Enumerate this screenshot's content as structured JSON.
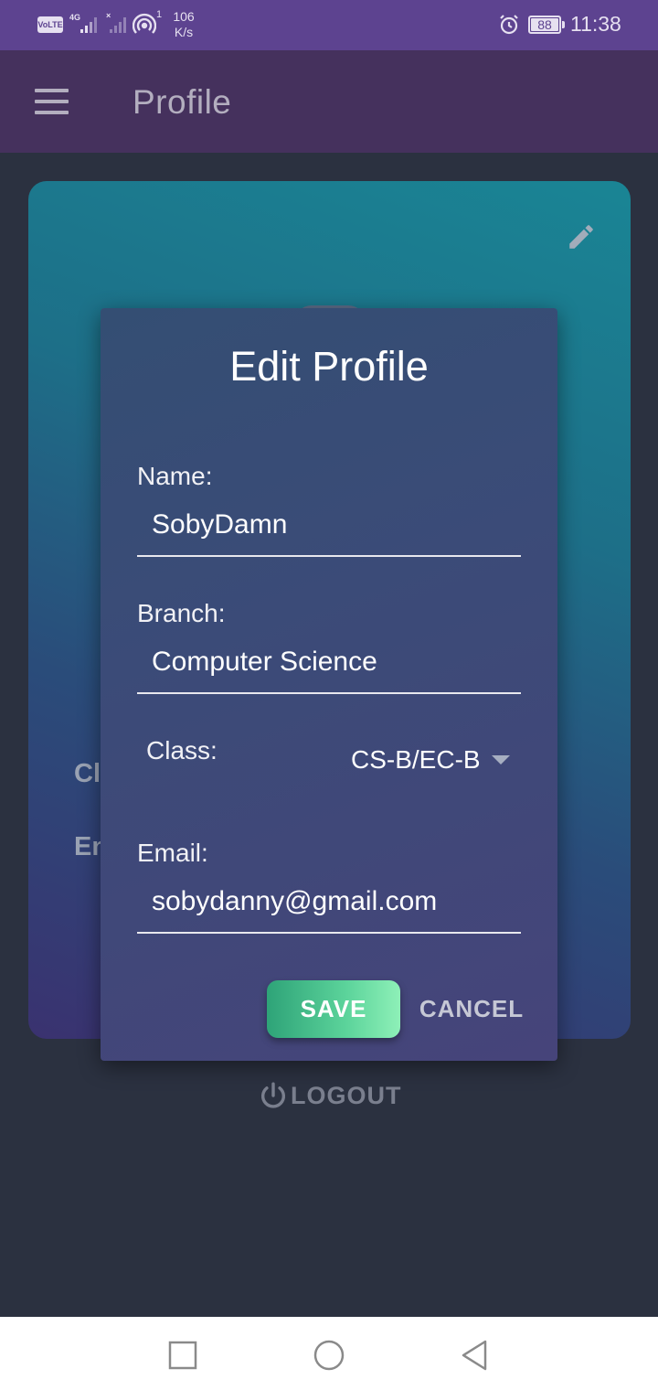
{
  "status_bar": {
    "volte": "VoLTE",
    "sim1_tag": "4G",
    "sim2_tag": "×",
    "hotspot_count": "1",
    "speed_value": "106",
    "speed_unit": "K/s",
    "battery": "88",
    "time": "11:38"
  },
  "app_bar": {
    "title": "Profile"
  },
  "profile_card": {
    "class_label_partial": "Cl",
    "email_label_partial": "En"
  },
  "dialog": {
    "title": "Edit Profile",
    "name_label": "Name:",
    "name_value": "SobyDamn",
    "branch_label": "Branch:",
    "branch_value": "Computer Science",
    "class_label": "Class:",
    "class_value": "CS-B/EC-B",
    "email_label": "Email:",
    "email_value": "sobydanny@gmail.com",
    "save_label": "SAVE",
    "cancel_label": "CANCEL"
  },
  "logout_label": "LOGOUT",
  "colors": {
    "status_bar": "#5d4390",
    "app_bar": "#45315d",
    "save_button": "#5cd49b"
  },
  "icons": [
    "menu-icon",
    "edit-pencil-icon",
    "power-icon",
    "nav-recents-icon",
    "nav-home-icon",
    "nav-back-icon"
  ]
}
